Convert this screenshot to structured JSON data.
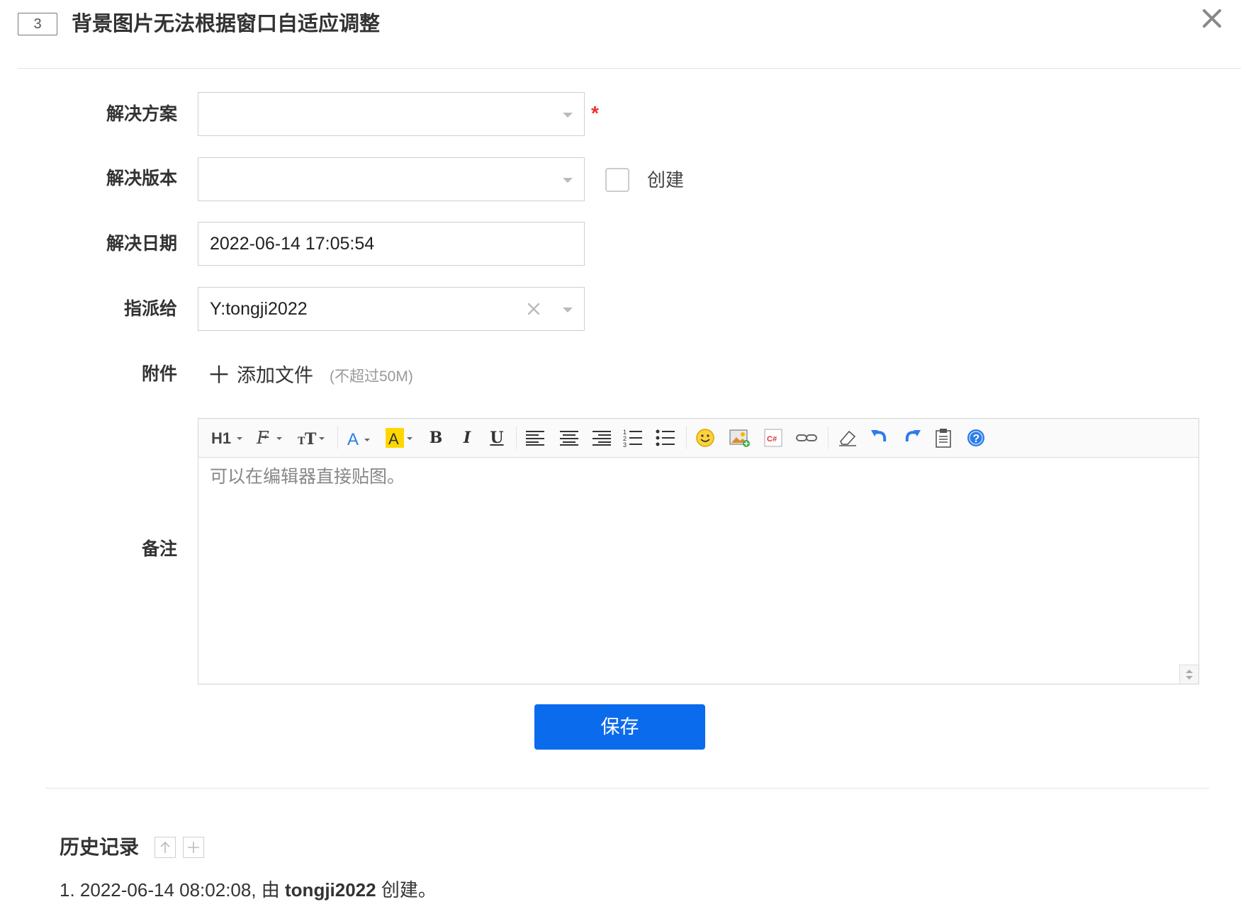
{
  "header": {
    "id": "3",
    "title": "背景图片无法根据窗口自适应调整"
  },
  "form": {
    "solution": {
      "label": "解决方案",
      "value": "",
      "required_mark": "*"
    },
    "version": {
      "label": "解决版本",
      "value": "",
      "create_label": "创建",
      "create_checked": false
    },
    "date": {
      "label": "解决日期",
      "value": "2022-06-14 17:05:54"
    },
    "assign": {
      "label": "指派给",
      "value": "Y:tongji2022"
    },
    "attachment": {
      "label": "附件",
      "add_label": "添加文件",
      "limit": "(不超过50M)"
    },
    "remark": {
      "label": "备注",
      "placeholder": "可以在编辑器直接贴图。"
    }
  },
  "toolbar_buttons": [
    "heading-icon",
    "font-family-icon",
    "font-size-icon",
    "font-color-icon",
    "highlight-icon",
    "bold-icon",
    "italic-icon",
    "underline-icon",
    "align-left-icon",
    "align-center-icon",
    "align-right-icon",
    "ordered-list-icon",
    "unordered-list-icon",
    "emoji-icon",
    "image-icon",
    "code-icon",
    "link-icon",
    "eraser-icon",
    "undo-icon",
    "redo-icon",
    "paste-icon",
    "help-icon"
  ],
  "save_label": "保存",
  "history": {
    "title": "历史记录",
    "entries": [
      {
        "prefix": "1. 2022-06-14 08:02:08, 由 ",
        "user": "tongji2022",
        "suffix": " 创建。"
      }
    ]
  },
  "colors": {
    "primary": "#0b6bed",
    "required": "#ee3333",
    "highlight": "#ffd700",
    "icon_blue": "#2b7de9"
  }
}
